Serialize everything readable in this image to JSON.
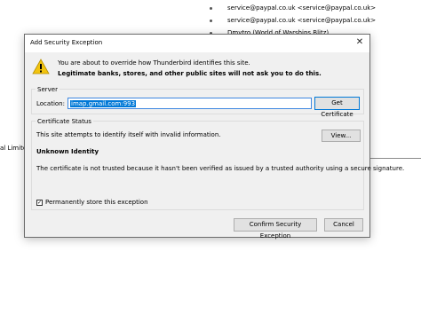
{
  "background": {
    "list_items": [
      "service@paypal.co.uk <service@paypal.co.uk>",
      "service@paypal.co.uk <service@paypal.co.uk>",
      "Dmytro (World of Warships Blitz)"
    ],
    "left_text": "al Limite"
  },
  "dialog": {
    "title": "Add Security Exception",
    "close_label": "✕",
    "intro_line1": "You are about to override how Thunderbird identifies this site.",
    "intro_line2": "Legitimate banks, stores, and other public sites will not ask you to do this.",
    "server": {
      "group_label": "Server",
      "location_label": "Location:",
      "location_value": "imap.gmail.com:993",
      "get_certificate_label": "Get Certificate"
    },
    "certificate_status": {
      "group_label": "Certificate Status",
      "invalid_info": "This site attempts to identify itself with invalid information.",
      "view_label": "View...",
      "unknown_identity": "Unknown Identity",
      "not_trusted": "The certificate is not trusted because it hasn't been verified as issued by a trusted authority using a secure signature.",
      "permanent_label": "Permanently store this exception",
      "permanent_checked": true
    },
    "confirm_label": "Confirm Security Exception",
    "cancel_label": "Cancel"
  },
  "colors": {
    "accent": "#0078d7",
    "warning": "#f2c40f"
  }
}
